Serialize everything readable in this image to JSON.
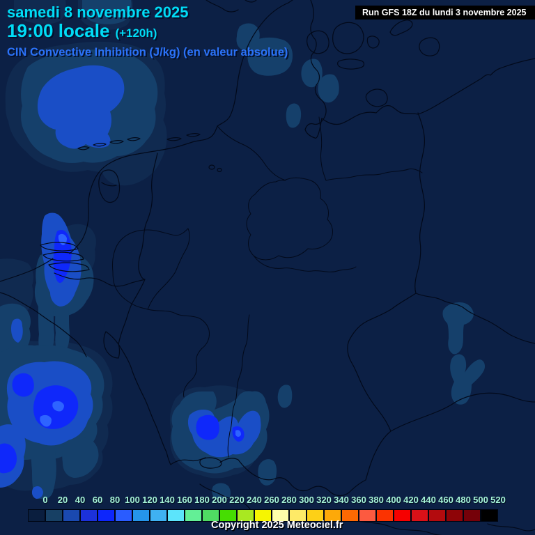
{
  "header": {
    "date_line": "samedi 8 novembre 2025",
    "time_line": "19:00 locale",
    "time_offset": "(+120h)",
    "subtitle": "CIN Convective Inhibition (J/kg) (en valeur absolue)",
    "run_info": "Run GFS 18Z du lundi 3 novembre 2025"
  },
  "footer": {
    "copyright": "Copyright 2025 Meteociel.fr"
  },
  "scale": {
    "ticks": [
      "0",
      "20",
      "40",
      "60",
      "80",
      "100",
      "120",
      "140",
      "160",
      "180",
      "200",
      "220",
      "240",
      "260",
      "280",
      "300",
      "320",
      "340",
      "360",
      "380",
      "400",
      "420",
      "440",
      "460",
      "480",
      "500",
      "520"
    ],
    "cell_colors": [
      "#0a1e3e",
      "#174064",
      "#1a49b0",
      "#1c31da",
      "#0d26fc",
      "#2a5cff",
      "#2595ea",
      "#3fb1f2",
      "#5ce4fb",
      "#63ef96",
      "#4fdb63",
      "#46dd02",
      "#a9e821",
      "#f6f501",
      "#fffeaa",
      "#feea67",
      "#fdd017",
      "#fda909",
      "#fd6903",
      "#fc5a40",
      "#fb3301",
      "#f60000",
      "#d91118",
      "#b30b0e",
      "#8e0407",
      "#750109",
      "#000000"
    ]
  },
  "colors": {
    "map_background": "#0c2045",
    "border_lines": "#02091a",
    "title_cyan": "#00dcf6",
    "subtitle_blue": "#2b72f8",
    "tick_text": "#a6f3d8",
    "run_bar_bg": "#000000",
    "run_bar_text": "#ffffff",
    "copyright_text": "#ffffff",
    "cin_levels": {
      "tint": "#102a50",
      "steel": "#15406b",
      "medium": "#1a4ec6",
      "bright": "#0f28fa",
      "peak": "#2e64ff"
    }
  }
}
